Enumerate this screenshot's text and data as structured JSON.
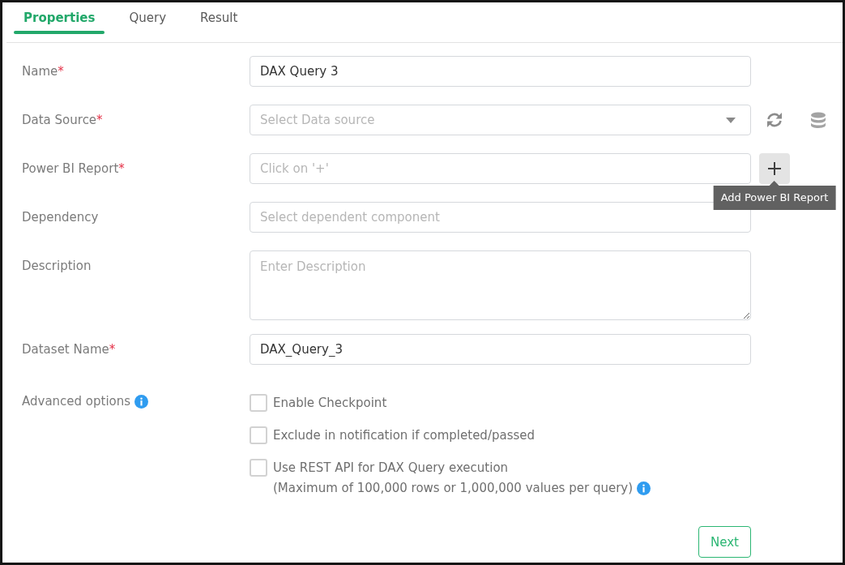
{
  "tabs": [
    {
      "label": "Properties",
      "selected": true
    },
    {
      "label": "Query",
      "selected": false
    },
    {
      "label": "Result",
      "selected": false
    }
  ],
  "fields": [
    {
      "kind": "text",
      "label": "Name",
      "required_mark": "*",
      "value": "DAX Query 3"
    },
    {
      "kind": "select",
      "label": "Data Source",
      "required_mark": "*",
      "placeholder": "Select Data source"
    },
    {
      "kind": "report",
      "label": "Power BI Report",
      "required_mark": "*",
      "placeholder": "Click on '+'",
      "tooltip": "Add Power BI Report"
    },
    {
      "kind": "text",
      "label": "Dependency",
      "placeholder": "Select dependent component"
    },
    {
      "kind": "textarea",
      "label": "Description",
      "placeholder": "Enter Description"
    },
    {
      "kind": "text",
      "label": "Dataset Name",
      "required_mark": "*",
      "value": "DAX_Query_3"
    }
  ],
  "advanced_options": {
    "label": "Advanced options",
    "options": [
      {
        "label": "Enable Checkpoint",
        "checked": false
      },
      {
        "label": "Exclude in notification if completed/passed",
        "checked": false
      },
      {
        "label": "Use REST API for DAX Query execution",
        "note": "(Maximum of 100,000 rows or 1,000,000 values per query)",
        "checked": false
      }
    ]
  },
  "next_button": {
    "label": "Next"
  }
}
